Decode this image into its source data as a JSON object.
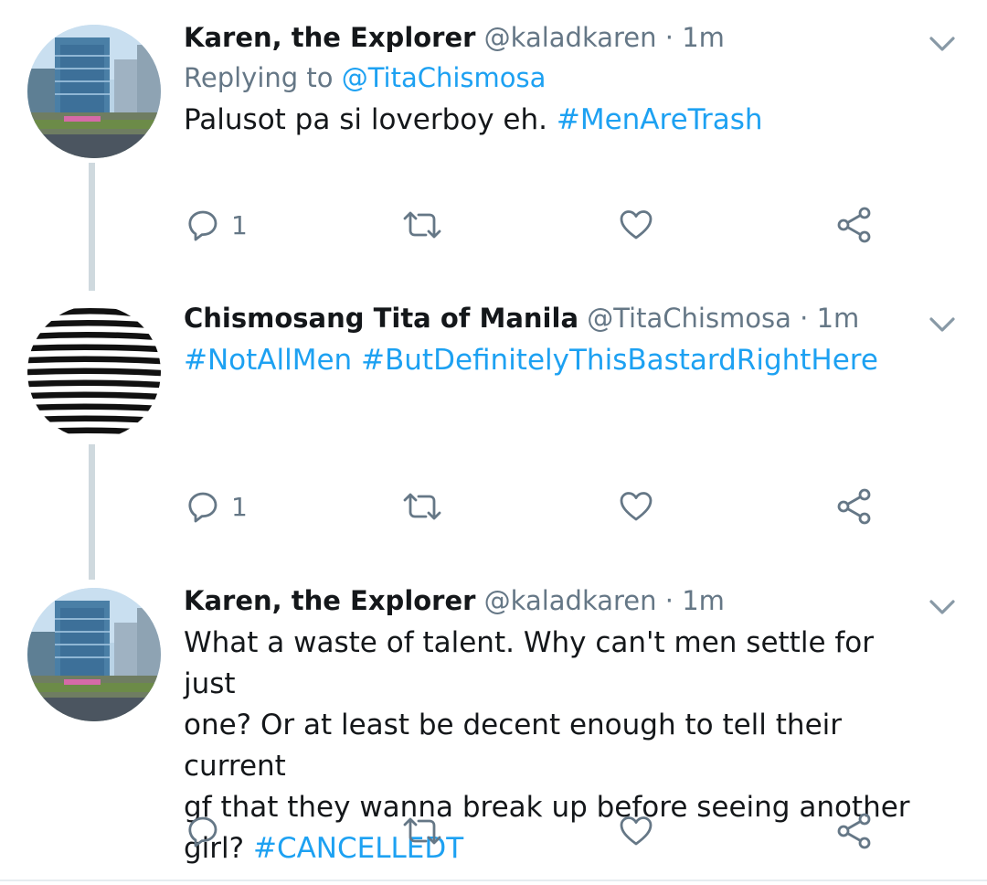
{
  "tweets": [
    {
      "name": "Karen, the Explorer",
      "handle": "@kaladkaren",
      "separator": "·",
      "time": "1m",
      "replying_prefix": "Replying to",
      "replying_to": "@TitaChismosa",
      "text": "Palusot pa si loverboy eh.",
      "hashtags": "#MenAreTrash",
      "reply_count": "1",
      "avatar": "city-photo"
    },
    {
      "name": "Chismosang Tita of Manila",
      "handle": "@TitaChismosa",
      "separator": "·",
      "time": "1m",
      "hashtags": "#NotAllMen #ButDefinitelyThisBastardRightHere",
      "reply_count": "1",
      "avatar": "black-white-stripes"
    },
    {
      "name": "Karen, the Explorer",
      "handle": "@kaladkaren",
      "separator": "·",
      "time": "1m",
      "text_lines": [
        "What a waste of talent. Why can't men settle for just",
        "one? Or at least be decent enough to tell their current",
        "gf that they wanna break up before seeing another",
        "girl?"
      ],
      "hashtag": "#CANCELLEDT",
      "reply_count": "",
      "avatar": "city-photo"
    }
  ],
  "icons": [
    "chevron-down-icon",
    "reply-icon",
    "retweet-icon",
    "like-icon",
    "share-icon"
  ],
  "colors": {
    "link": "#1da1f2",
    "secondary": "#657786",
    "text": "#14171a",
    "thread_line": "#cfd9de"
  }
}
